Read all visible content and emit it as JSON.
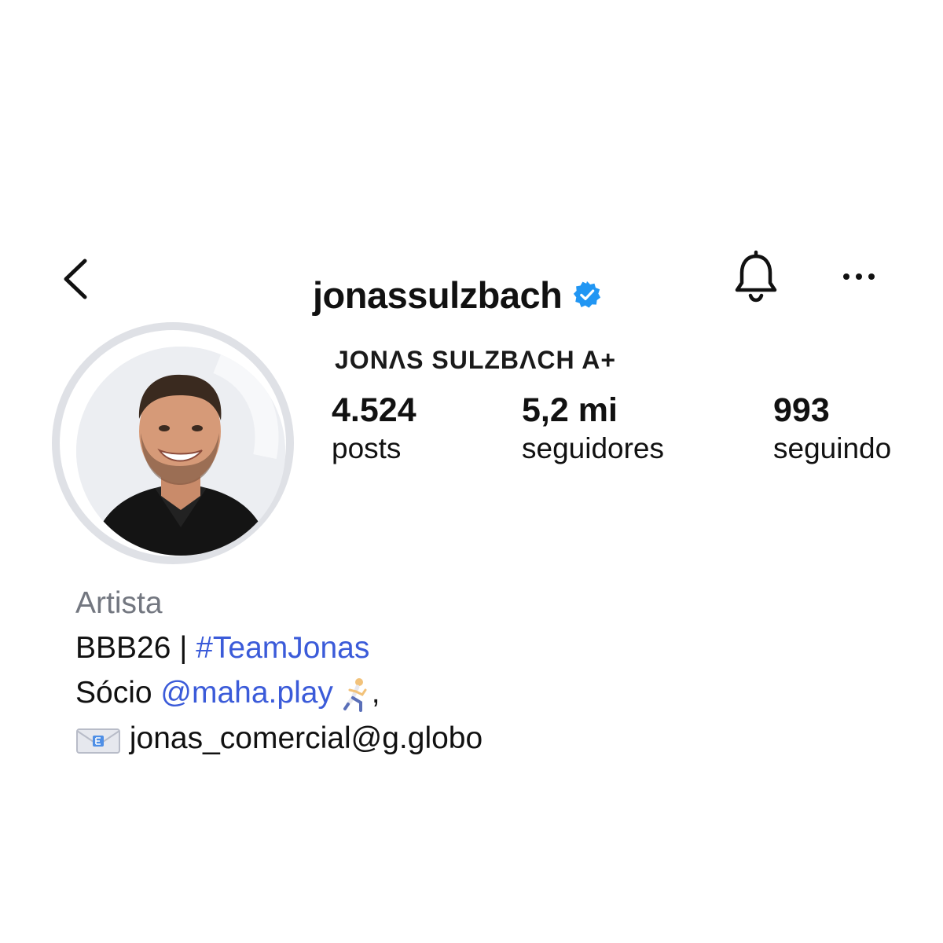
{
  "header": {
    "username": "jonassulzbach",
    "back_icon": "chevron-left-icon",
    "verified_icon": "verified-badge-icon",
    "notifications_icon": "bell-icon",
    "more_icon": "more-horizontal-icon"
  },
  "profile": {
    "display_name": "JONΛS SULZBΛCH A+",
    "avatar": "profile-photo"
  },
  "stats": [
    {
      "value": "4.524",
      "label": "posts"
    },
    {
      "value": "5,2 mi",
      "label": "seguidores"
    },
    {
      "value": "993",
      "label": "seguindo"
    }
  ],
  "bio": {
    "category": "Artista",
    "line1_prefix": "BBB26 | ",
    "line1_hashtag": "#TeamJonas",
    "line2_prefix": "Sócio ",
    "line2_mention": "@maha.play",
    "line2_suffix": ",",
    "line2_emoji": "running-man-emoji",
    "line3_emoji": "envelope-emoji",
    "line3_email": "jonas_comercial@g.globo"
  },
  "colors": {
    "link": "#3b5bd9",
    "verified": "#2196f3",
    "category": "#737780",
    "avatar_ring": "#dfe1e6"
  }
}
